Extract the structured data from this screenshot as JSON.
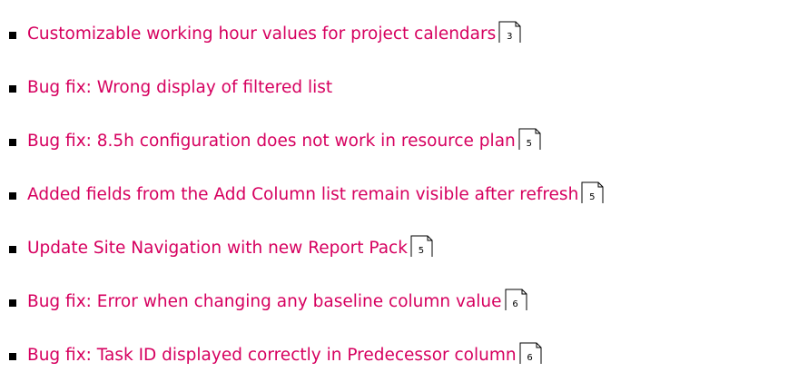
{
  "accent_color": "#d6005f",
  "items": [
    {
      "title": "Customizable working hour values for project calendars",
      "page": "3"
    },
    {
      "title": "Bug fix: Wrong display of filtered list",
      "page": ""
    },
    {
      "title": "Bug fix: 8.5h configuration does not work in resource plan",
      "page": "5"
    },
    {
      "title": "Added fields from the Add Column list remain visible after refresh",
      "page": "5"
    },
    {
      "title": "Update Site Navigation with new Report Pack",
      "page": "5"
    },
    {
      "title": "Bug fix: Error when changing any baseline column value",
      "page": "6"
    },
    {
      "title": "Bug fix: Task ID displayed correctly in Predecessor column",
      "page": "6"
    }
  ]
}
